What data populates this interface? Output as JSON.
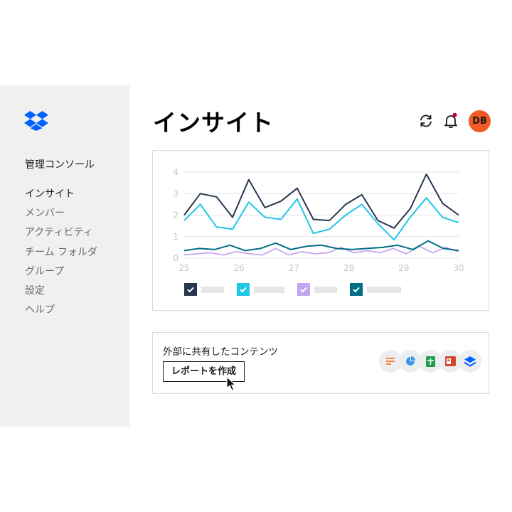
{
  "sidebar": {
    "console_title": "管理コンソール",
    "items": [
      {
        "label": "インサイト",
        "active": true
      },
      {
        "label": "メンバー",
        "active": false
      },
      {
        "label": "アクティビティ",
        "active": false
      },
      {
        "label": "チーム フォルダ",
        "active": false
      },
      {
        "label": "グループ",
        "active": false
      },
      {
        "label": "設定",
        "active": false
      },
      {
        "label": "ヘルプ",
        "active": false
      }
    ]
  },
  "header": {
    "title": "インサイト",
    "avatar_initials": "DB",
    "icons": [
      "refresh-icon",
      "bell-icon"
    ]
  },
  "colors": {
    "brand": "#0061ff",
    "avatar": "#f15a22",
    "series": [
      "#283750",
      "#1fc6e8",
      "#c3a6f0",
      "#006e85"
    ]
  },
  "chart_data": {
    "type": "line",
    "x": [
      25,
      25.25,
      25.5,
      25.75,
      26,
      26.25,
      26.5,
      26.75,
      27,
      27.25,
      27.5,
      27.75,
      28,
      28.25,
      28.5,
      28.75,
      29,
      29.25,
      29.5,
      29.75,
      30
    ],
    "x_ticks": [
      "25",
      "26",
      "27",
      "28",
      "29",
      "30"
    ],
    "y_ticks": [
      "0",
      "1",
      "2",
      "3",
      "4"
    ],
    "ylim": [
      0,
      4
    ],
    "xlim": [
      25,
      30
    ],
    "grid": true,
    "legend": "bottom-left",
    "series": [
      {
        "values": [
          2.0,
          3.0,
          2.85,
          1.9,
          3.65,
          2.35,
          2.65,
          3.25,
          1.8,
          1.75,
          2.5,
          2.95,
          1.75,
          1.4,
          2.3,
          3.9,
          2.55,
          2.0
        ]
      },
      {
        "values": [
          1.75,
          2.5,
          1.45,
          1.35,
          2.6,
          1.9,
          1.8,
          2.75,
          1.15,
          1.35,
          2.0,
          2.5,
          1.6,
          0.85,
          1.9,
          2.8,
          1.9,
          1.65
        ]
      },
      {
        "values": [
          0.15,
          0.2,
          0.25,
          0.15,
          0.3,
          0.2,
          0.15,
          0.45,
          0.15,
          0.3,
          0.2,
          0.25,
          0.5,
          0.25,
          0.35,
          0.25,
          0.45,
          0.2,
          0.55,
          0.25,
          0.5,
          0.3
        ]
      },
      {
        "values": [
          0.35,
          0.45,
          0.4,
          0.6,
          0.35,
          0.45,
          0.7,
          0.4,
          0.55,
          0.6,
          0.45,
          0.4,
          0.45,
          0.5,
          0.6,
          0.4,
          0.8,
          0.45,
          0.35
        ]
      }
    ]
  },
  "share_card": {
    "title": "外部に共有したコンテンツ",
    "button_label": "レポートを作成",
    "file_icons": [
      "document-icon",
      "pie-chart-icon",
      "spreadsheet-icon",
      "presentation-icon",
      "dropbox-paper-icon"
    ]
  }
}
